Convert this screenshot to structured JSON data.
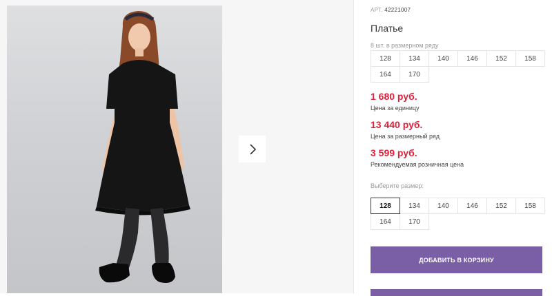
{
  "gallery": {
    "photo_alt": "",
    "next_icon": "chevron-right-icon"
  },
  "product": {
    "art_label": "АРТ.",
    "art_number": "42221007",
    "title": "Платье",
    "pack_label": "8 шт. в размерном ряду",
    "pack_sizes": [
      "128",
      "134",
      "140",
      "146",
      "152",
      "158",
      "164",
      "170"
    ]
  },
  "prices": [
    {
      "value": "1 680 руб.",
      "note": "Цена за единицу"
    },
    {
      "value": "13 440 руб.",
      "note": "Цена за размерный ряд"
    },
    {
      "value": "3 599 руб.",
      "note": "Рекомендуемая розничная цена"
    }
  ],
  "size_picker": {
    "label": "Выберите размер:",
    "sizes": [
      "128",
      "134",
      "140",
      "146",
      "152",
      "158",
      "164",
      "170"
    ],
    "selected": "128"
  },
  "actions": {
    "add_to_cart": "ДОБАВИТЬ В КОРЗИНУ"
  },
  "colors": {
    "accent": "#7b5fa6",
    "price": "#e0203a"
  }
}
